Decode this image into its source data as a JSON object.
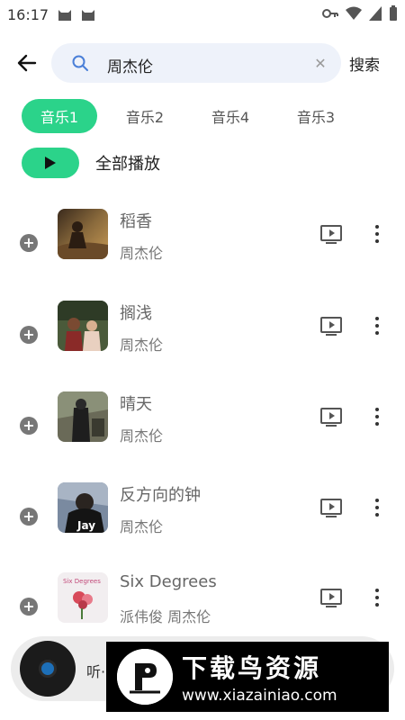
{
  "status_bar": {
    "time": "16:17"
  },
  "search": {
    "query": "周杰伦",
    "submit_label": "搜索"
  },
  "tabs": [
    {
      "label": "音乐1",
      "active": true
    },
    {
      "label": "音乐2",
      "active": false
    },
    {
      "label": "音乐4",
      "active": false
    },
    {
      "label": "音乐3",
      "active": false
    }
  ],
  "play_all": {
    "label": "全部播放"
  },
  "songs": [
    {
      "title": "稻香",
      "artist": "周杰伦"
    },
    {
      "title": "搁浅",
      "artist": "周杰伦"
    },
    {
      "title": "晴天",
      "artist": "周杰伦"
    },
    {
      "title": "反方向的钟",
      "artist": "周杰伦",
      "cover_text": "Jay"
    },
    {
      "title": "Six Degrees",
      "artist": "派伟俊 周杰伦",
      "cover_text": "Six Degrees"
    }
  ],
  "player": {
    "text": "听·"
  },
  "watermark": {
    "title": "下载鸟资源",
    "url": "www.xiazainiao.com"
  },
  "colors": {
    "accent": "#2bd38a",
    "search_bg": "#eef2fa"
  },
  "icons": {
    "back": "arrow-left-icon",
    "search": "search-icon",
    "clear": "close-icon",
    "play": "play-icon",
    "add": "add-circle-icon",
    "mv": "video-play-icon",
    "more": "more-vertical-icon"
  }
}
